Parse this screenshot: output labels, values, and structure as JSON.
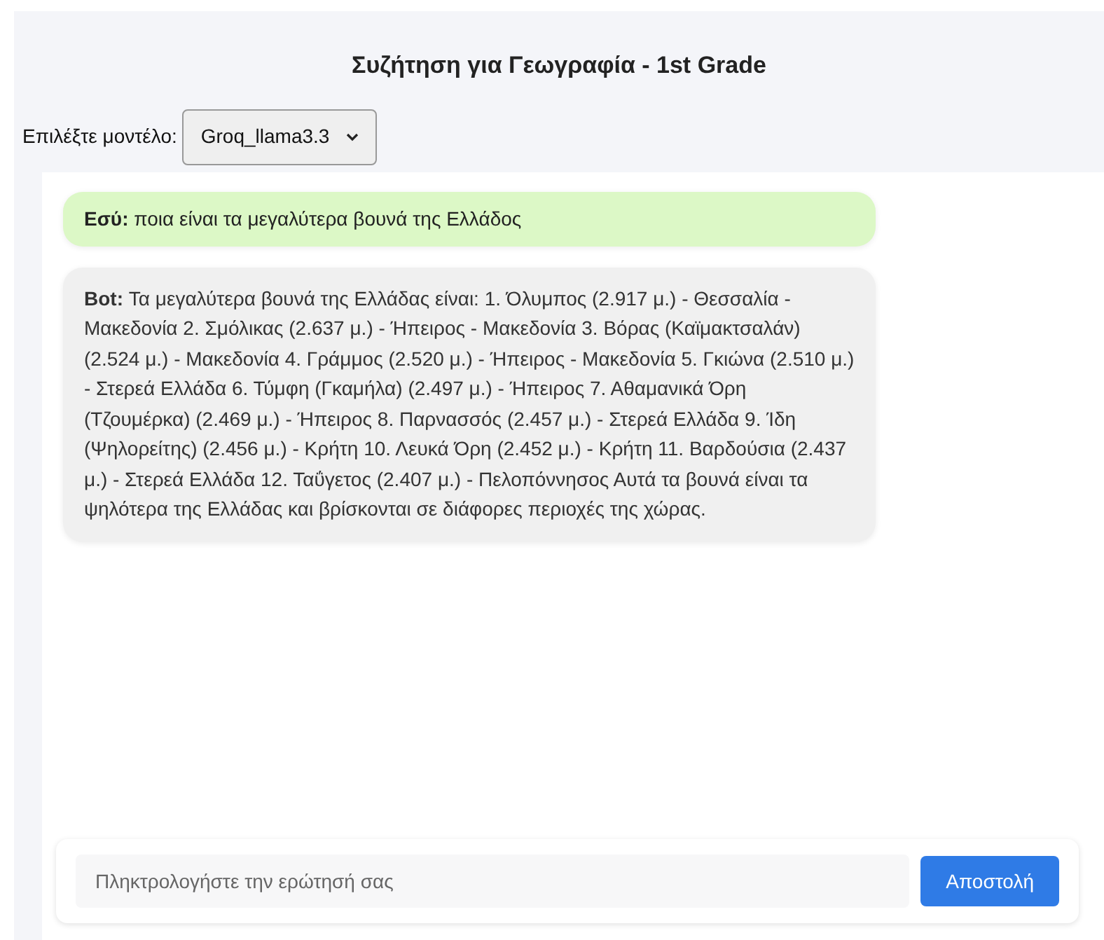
{
  "title": "Συζήτηση για Γεωγραφία - 1st Grade",
  "model_select": {
    "label": "Επιλέξτε μοντέλο:",
    "value": "Groq_llama3.3"
  },
  "messages": [
    {
      "kind": "user",
      "sender": "Εσύ:",
      "text": "ποια είναι τα μεγαλύτερα βουνά της Ελλάδος"
    },
    {
      "kind": "bot",
      "sender": "Bot:",
      "text": "Τα μεγαλύτερα βουνά της Ελλάδας είναι: 1. Όλυμπος (2.917 μ.) - Θεσσαλία - Μακεδονία 2. Σμόλικας (2.637 μ.) - Ήπειρος - Μακεδονία 3. Βόρας (Καϊμακτσαλάν) (2.524 μ.) - Μακεδονία 4. Γράμμος (2.520 μ.) - Ήπειρος - Μακεδονία 5. Γκιώνα (2.510 μ.) - Στερεά Ελλάδα 6. Τύμφη (Γκαμήλα) (2.497 μ.) - Ήπειρος 7. Αθαμανικά Όρη (Τζουμέρκα) (2.469 μ.) - Ήπειρος 8. Παρνασσός (2.457 μ.) - Στερεά Ελλάδα 9. Ίδη (Ψηλορείτης) (2.456 μ.) - Κρήτη 10. Λευκά Όρη (2.452 μ.) - Κρήτη 11. Βαρδούσια (2.437 μ.) - Στερεά Ελλάδα 12. Ταΰγετος (2.407 μ.) - Πελοπόννησος Αυτά τα βουνά είναι τα ψηλότερα της Ελλάδας και βρίσκονται σε διάφορες περιοχές της χώρας."
    }
  ],
  "input": {
    "placeholder": "Πληκτρολογήστε την ερώτησή σας"
  },
  "send_button": "Αποστολή"
}
